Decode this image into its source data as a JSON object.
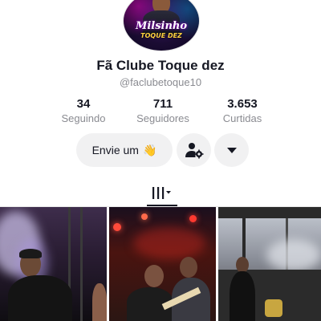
{
  "profile": {
    "avatar_text": "Milsinho",
    "avatar_subtext": "TOQUE DEZ",
    "name": "Fã Clube Toque dez",
    "handle": "@faclubetoque10"
  },
  "stats": [
    {
      "value": "34",
      "label": "Seguindo"
    },
    {
      "value": "711",
      "label": "Seguidores"
    },
    {
      "value": "3.653",
      "label": "Curtidas"
    }
  ],
  "actions": {
    "message_label": "Envie um",
    "message_emoji": "👋",
    "add_friend_icon": "add-friend-icon",
    "more_icon": "caret-down-icon"
  },
  "tabs": {
    "videos_icon": "grid-icon"
  },
  "colors": {
    "text": "#161823",
    "secondary": "#8a8b91",
    "button_bg": "#f1f1f2"
  }
}
